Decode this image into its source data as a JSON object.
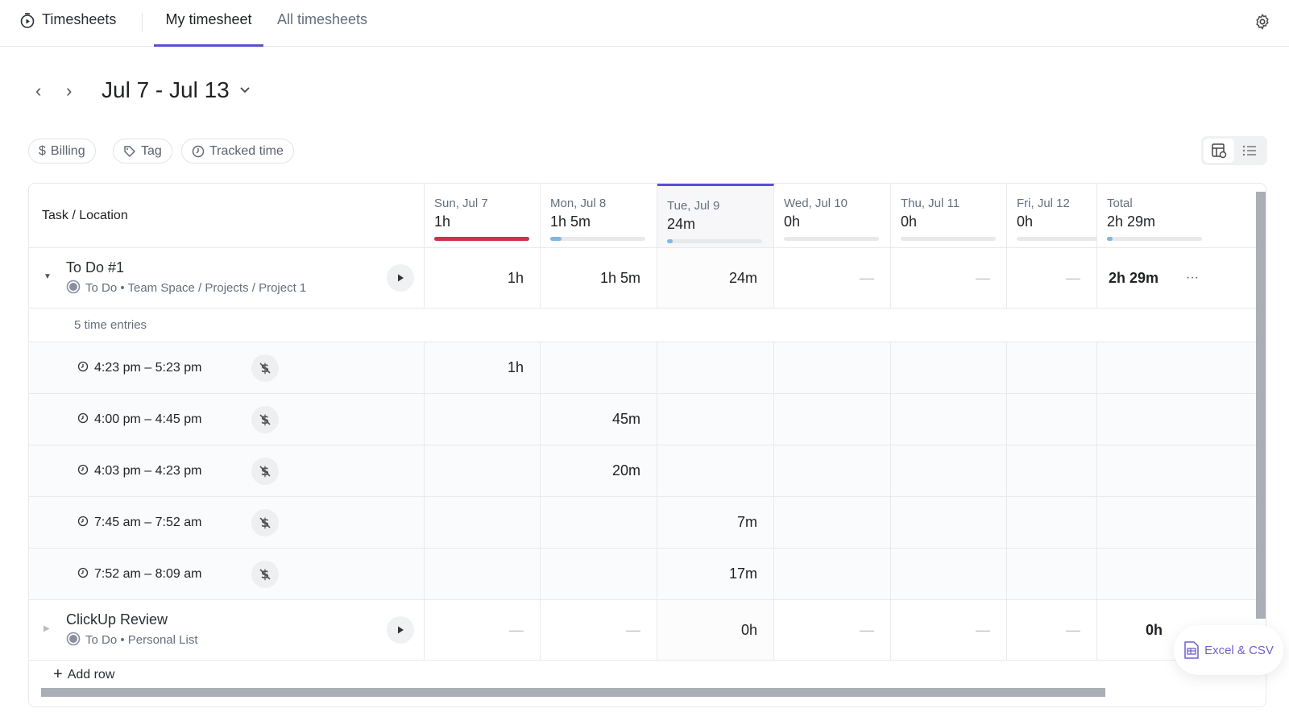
{
  "header": {
    "app_title": "Timesheets",
    "tabs": [
      {
        "label": "My timesheet",
        "active": true
      },
      {
        "label": "All timesheets",
        "active": false
      }
    ]
  },
  "date_range": {
    "label": "Jul 7 - Jul 13"
  },
  "filters": [
    {
      "label": "Billing",
      "icon": "dollar-icon"
    },
    {
      "label": "Tag",
      "icon": "tag-icon"
    },
    {
      "label": "Tracked time",
      "icon": "clock-icon"
    }
  ],
  "colors": {
    "accent": "#5b4fd6",
    "over": "#d0304a",
    "progress": "#7fb7e4"
  },
  "table": {
    "task_header": "Task / Location",
    "days": [
      {
        "label": "Sun, Jul 7",
        "total": "1h",
        "progress": 100,
        "color": "#d0304a"
      },
      {
        "label": "Mon, Jul 8",
        "total": "1h 5m",
        "progress": 12,
        "color": "#7fb7e4"
      },
      {
        "label": "Tue, Jul 9",
        "total": "24m",
        "progress": 5,
        "color": "#7fb7e4",
        "today": true
      },
      {
        "label": "Wed, Jul 10",
        "total": "0h",
        "progress": 0
      },
      {
        "label": "Thu, Jul 11",
        "total": "0h",
        "progress": 0
      },
      {
        "label": "Fri, Jul 12",
        "total": "0h",
        "progress": 0
      },
      {
        "label": "Total",
        "total": "2h 29m",
        "progress": 5,
        "color": "#7fb7e4"
      }
    ],
    "tasks": [
      {
        "name": "To Do #1",
        "status": "To Do",
        "location": "To Do • Team Space / Projects / Project 1",
        "expanded": true,
        "values": [
          "1h",
          "1h 5m",
          "24m",
          "—",
          "—",
          "—"
        ],
        "total": "2h 29m",
        "more": "···",
        "entries_label": "5 time entries",
        "entries": [
          {
            "time": "4:23 pm – 5:23 pm",
            "values": [
              "1h",
              "",
              "",
              "",
              "",
              ""
            ]
          },
          {
            "time": "4:00 pm – 4:45 pm",
            "values": [
              "",
              "45m",
              "",
              "",
              "",
              ""
            ]
          },
          {
            "time": "4:03 pm – 4:23 pm",
            "values": [
              "",
              "20m",
              "",
              "",
              "",
              ""
            ]
          },
          {
            "time": "7:45 am – 7:52 am",
            "values": [
              "",
              "",
              "7m",
              "",
              "",
              ""
            ]
          },
          {
            "time": "7:52 am – 8:09 am",
            "values": [
              "",
              "",
              "17m",
              "",
              "",
              ""
            ]
          }
        ]
      },
      {
        "name": "ClickUp Review",
        "location": "To Do • Personal List",
        "expanded": false,
        "values": [
          "—",
          "—",
          "0h",
          "—",
          "—",
          "—"
        ],
        "total": "0h"
      }
    ],
    "add_row": "Add row"
  },
  "export": {
    "label": "Excel & CSV"
  }
}
